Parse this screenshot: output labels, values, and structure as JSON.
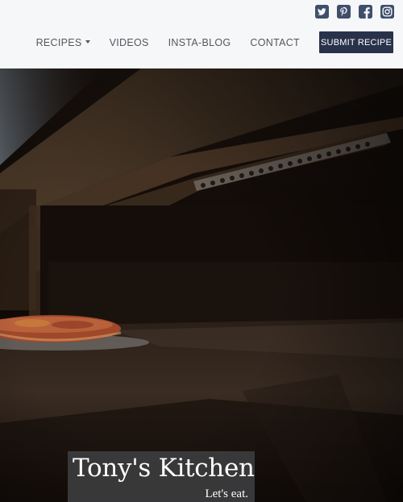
{
  "social": {
    "icons": [
      "twitter-icon",
      "pinterest-icon",
      "facebook-icon",
      "instagram-icon"
    ],
    "color": "#3f4e6b"
  },
  "nav": {
    "recipes": "RECIPES",
    "videos": "VIDEOS",
    "insta_blog": "INSTA-BLOG",
    "contact": "CONTACT",
    "submit": "SUBMIT RECIPE"
  },
  "brand": {
    "title": "Tony's Kitchen",
    "tagline": "Let's eat."
  },
  "colors": {
    "submit_bg": "#28324a",
    "nav_text": "#55575c",
    "header_bg": "#f6f7f9"
  }
}
